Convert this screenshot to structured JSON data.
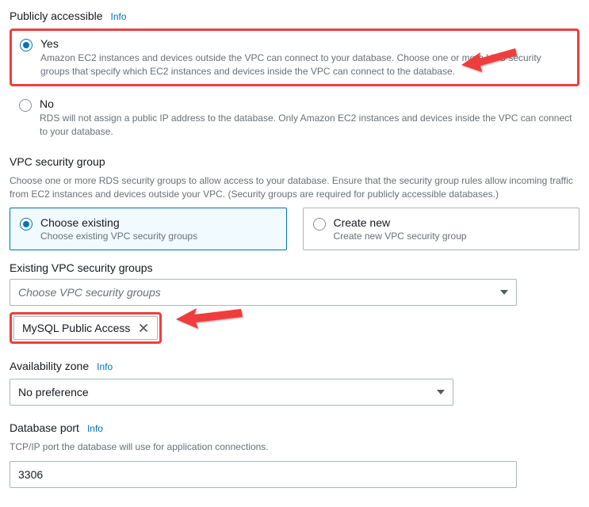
{
  "publicly_accessible": {
    "title": "Publicly accessible",
    "info": "Info",
    "yes_label": "Yes",
    "yes_desc": "Amazon EC2 instances and devices outside the VPC can connect to your database. Choose one or more VPC security groups that specify which EC2 instances and devices inside the VPC can connect to the database.",
    "no_label": "No",
    "no_desc": "RDS will not assign a public IP address to the database. Only Amazon EC2 instances and devices inside the VPC can connect to your database."
  },
  "vpc_sg": {
    "title": "VPC security group",
    "help": "Choose one or more RDS security groups to allow access to your database. Ensure that the security group rules allow incoming traffic from EC2 instances and devices outside your VPC. (Security groups are required for publicly accessible databases.)",
    "choose_existing_label": "Choose existing",
    "choose_existing_desc": "Choose existing VPC security groups",
    "create_new_label": "Create new",
    "create_new_desc": "Create new VPC security group",
    "existing_label": "Existing VPC security groups",
    "dropdown_placeholder": "Choose VPC security groups",
    "chip_label": "MySQL Public Access"
  },
  "az": {
    "title": "Availability zone",
    "info": "Info",
    "value": "No preference"
  },
  "port": {
    "title": "Database port",
    "info": "Info",
    "help": "TCP/IP port the database will use for application connections.",
    "value": "3306"
  }
}
